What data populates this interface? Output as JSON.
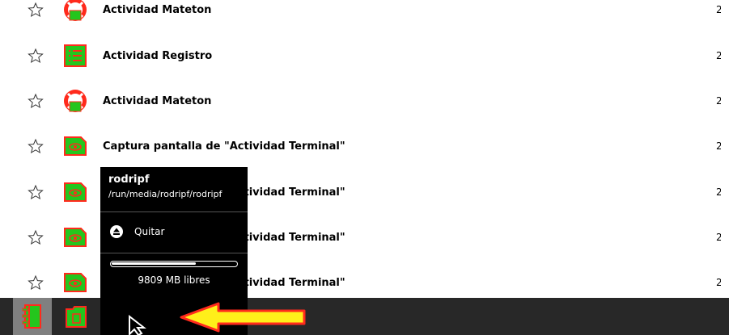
{
  "journal": {
    "rows": [
      {
        "title": "Actividad Mateton",
        "icon": "mateton-icon",
        "right": "2"
      },
      {
        "title": "Actividad Registro",
        "icon": "registro-icon",
        "right": "2"
      },
      {
        "title": "Actividad Mateton",
        "icon": "mateton-icon",
        "right": "2"
      },
      {
        "title": "Captura pantalla de \"Actividad Terminal\"",
        "icon": "image-icon",
        "right": "2"
      },
      {
        "title": "Captura pantalla de \"Actividad Terminal\"",
        "icon": "image-icon",
        "right": "2"
      },
      {
        "title": "Captura pantalla de \"Actividad Terminal\"",
        "icon": "image-icon",
        "right": "2"
      },
      {
        "title": "Captura pantalla de \"Actividad Terminal\"",
        "icon": "image-icon",
        "right": "2"
      }
    ]
  },
  "palette": {
    "title": "rodripf",
    "path": "/run/media/rodripf/rodripf",
    "remove_label": "Quitar",
    "free_label": "9809 MB libres",
    "usage_fraction": 0.68
  },
  "tray": {
    "buttons": [
      "journal-icon",
      "documents-icon",
      "usb-drive-icon"
    ]
  },
  "colors": {
    "icon_fill": "#24c61d",
    "icon_stroke": "#ff2a1c",
    "frame": "#282828",
    "palette_bg": "#000000",
    "annotation_arrow": "#ffef1a"
  }
}
